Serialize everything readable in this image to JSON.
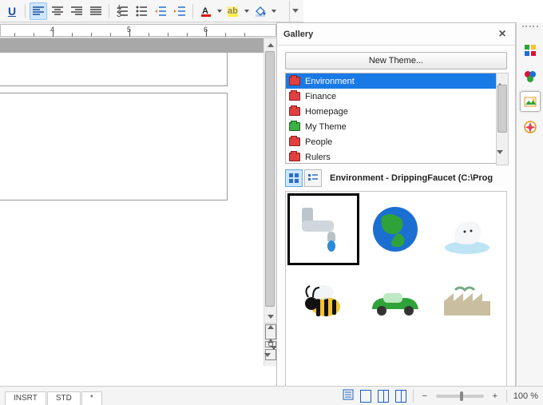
{
  "toolbar": {
    "underline_letter": "U"
  },
  "ruler": {
    "numbers": [
      "4",
      "5",
      "6"
    ]
  },
  "status": {
    "left_mode": "INSRT",
    "std": "STD",
    "star": "*"
  },
  "gallery": {
    "title": "Gallery",
    "new_theme_label": "New Theme...",
    "themes": [
      "Environment",
      "Finance",
      "Homepage",
      "My Theme",
      "People",
      "Rulers"
    ],
    "selected_theme_index": 0,
    "path_label": "Environment - DrippingFaucet (C:\\Prog",
    "items": [
      "DrippingFaucet",
      "Earth",
      "PolarBear",
      "Bee",
      "GreenCar",
      "Factory"
    ],
    "selected_item_index": 0
  },
  "status_right": {
    "zoom_label": "100 %"
  }
}
